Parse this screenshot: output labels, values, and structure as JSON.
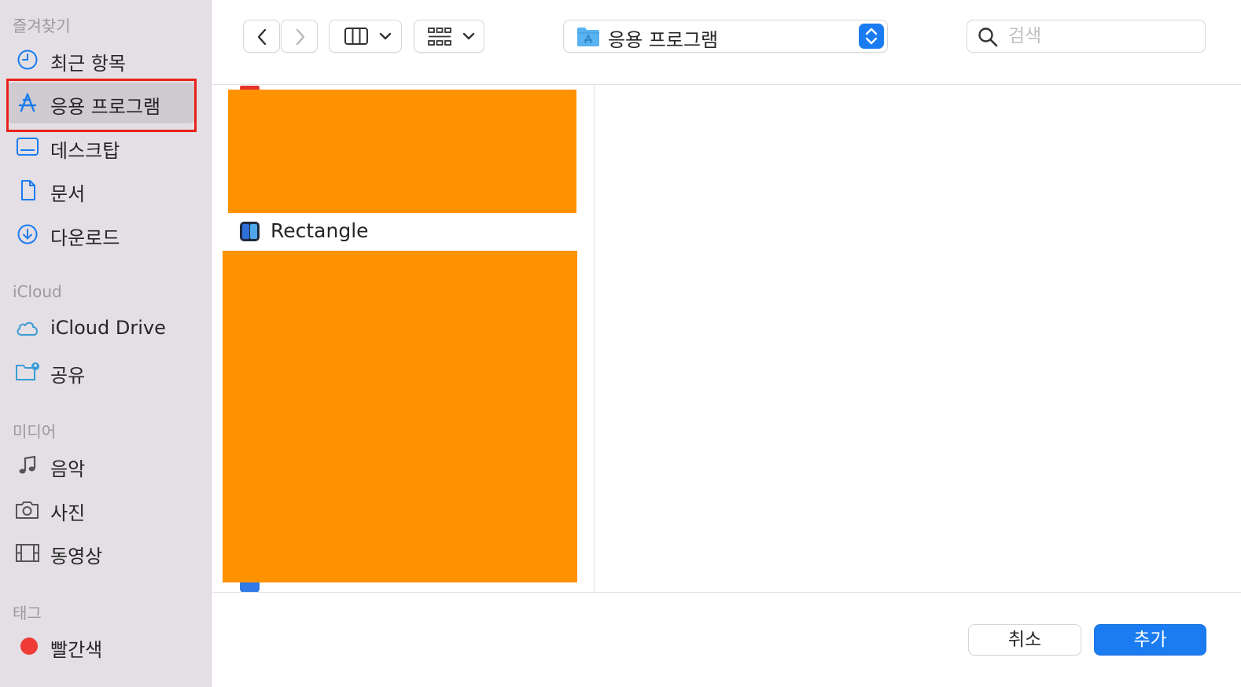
{
  "sidebar": {
    "favorites_title": "즐겨찾기",
    "favorites": [
      {
        "label": "최근 항목",
        "icon": "clock-icon"
      },
      {
        "label": "응용 프로그램",
        "icon": "app-store-icon",
        "selected": true
      },
      {
        "label": "데스크탑",
        "icon": "desktop-icon"
      },
      {
        "label": "문서",
        "icon": "document-icon"
      },
      {
        "label": "다운로드",
        "icon": "download-icon"
      }
    ],
    "icloud_title": "iCloud",
    "icloud": [
      {
        "label": "iCloud Drive",
        "icon": "cloud-icon"
      },
      {
        "label": "공유",
        "icon": "shared-folder-icon"
      }
    ],
    "media_title": "미디어",
    "media": [
      {
        "label": "음악",
        "icon": "music-note-icon"
      },
      {
        "label": "사진",
        "icon": "camera-icon"
      },
      {
        "label": "동영상",
        "icon": "film-icon"
      }
    ],
    "tags_title": "태그",
    "tags": [
      {
        "label": "빨간색",
        "color": "#ef3b36"
      }
    ],
    "accent_color": "#1a7cf0",
    "highlight_color": "#e8231c"
  },
  "toolbar": {
    "path_label": "응용 프로그램",
    "search_placeholder": "검색"
  },
  "browser": {
    "items": [
      {
        "label": "Rectangle",
        "icon": "rectangle-app-icon"
      }
    ],
    "redaction_color": "#ff9200"
  },
  "footer": {
    "cancel_label": "취소",
    "add_label": "추가"
  }
}
